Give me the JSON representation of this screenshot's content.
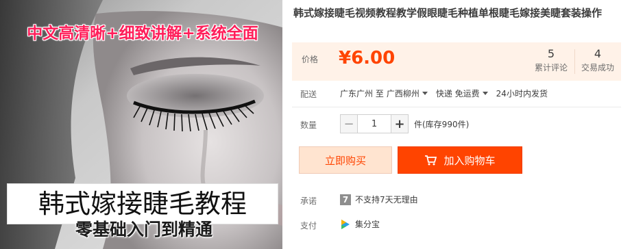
{
  "gallery": {
    "promo_text": "中文高清晰+细致讲解+系统全面",
    "banner_title": "韩式嫁接睫毛教程",
    "banner_subtitle": "零基础入门到精通"
  },
  "product": {
    "title": "韩式嫁接睫毛视频教程教学假眼睫毛种植单根睫毛嫁接美睫套装操作"
  },
  "price": {
    "label": "价格",
    "value": "¥6.00",
    "reviews_count": "5",
    "reviews_label": "累计评论",
    "deals_count": "4",
    "deals_label": "交易成功"
  },
  "shipping": {
    "label": "配送",
    "origin": "广东广州 至",
    "destination": "广西柳州",
    "method": "快递 免运费",
    "dispatch": "24小时内发货"
  },
  "quantity": {
    "label": "数量",
    "value": "1",
    "stock": "件(库存990件)"
  },
  "actions": {
    "buy_now": "立即购买",
    "add_to_cart": "加入购物车"
  },
  "promise": {
    "label": "承诺",
    "badge": "7",
    "text": "不支持7天无理由"
  },
  "payment": {
    "label": "支付",
    "method": "集分宝"
  },
  "colors": {
    "accent": "#ff4400",
    "price_bg": "#fff2e8",
    "buy_bg": "#ffe4d0",
    "promo_text": "#ff1e5a"
  }
}
